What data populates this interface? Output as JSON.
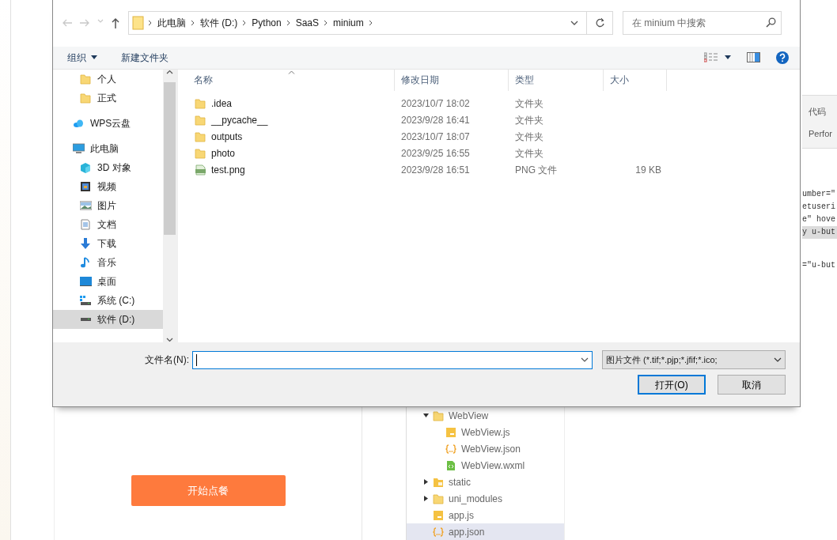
{
  "background": {
    "preview": {
      "button": "开始点餐"
    },
    "project_tree": {
      "items": [
        {
          "label": "WebView",
          "kind": "folder",
          "expanded": true,
          "selected": false,
          "children": [
            {
              "label": "WebView.js",
              "kind": "js",
              "selected": false
            },
            {
              "label": "WebView.json",
              "kind": "json",
              "selected": false
            },
            {
              "label": "WebView.wxml",
              "kind": "wxml",
              "selected": false
            }
          ]
        },
        {
          "label": "static",
          "kind": "folder-static",
          "expanded": false,
          "selected": false
        },
        {
          "label": "uni_modules",
          "kind": "folder",
          "expanded": false,
          "selected": false
        },
        {
          "label": "app.js",
          "kind": "js",
          "selected": false
        },
        {
          "label": "app.json",
          "kind": "json",
          "selected": true
        }
      ]
    },
    "side_tabs": [
      "代码",
      "Perfor"
    ],
    "code_lines": [
      {
        "text": "umber=\"",
        "highlighted": false
      },
      {
        "text": "etuseri",
        "highlighted": false
      },
      {
        "text": "e\" hove",
        "highlighted": false
      },
      {
        "text": "y u-but",
        "highlighted": true
      },
      {
        "text": "=\"u-but",
        "highlighted": false
      }
    ]
  },
  "dialog": {
    "nav_buttons": [
      {
        "kind": "back",
        "disabled": true
      },
      {
        "kind": "forward",
        "disabled": true
      },
      {
        "kind": "recent",
        "disabled": true
      },
      {
        "kind": "up",
        "disabled": false
      }
    ],
    "breadcrumbs": [
      "此电脑",
      "软件 (D:)",
      "Python",
      "SaaS",
      "minium"
    ],
    "search": {
      "placeholder": "在 minium 中搜索"
    },
    "toolbar": {
      "organize": "组织",
      "new_folder": "新建文件夹"
    },
    "nav_pane": {
      "items": [
        {
          "label": "个人",
          "kind": "folder",
          "selected": false
        },
        {
          "label": "正式",
          "kind": "folder",
          "selected": false
        },
        {
          "label": "WPS云盘",
          "kind": "cloud",
          "selected": false
        },
        {
          "label": "此电脑",
          "kind": "pc",
          "selected": false
        },
        {
          "label": "3D 对象",
          "kind": "cube",
          "selected": false
        },
        {
          "label": "视频",
          "kind": "film",
          "selected": false
        },
        {
          "label": "图片",
          "kind": "image",
          "selected": false
        },
        {
          "label": "文档",
          "kind": "doc",
          "selected": false
        },
        {
          "label": "下载",
          "kind": "download",
          "selected": false
        },
        {
          "label": "音乐",
          "kind": "music",
          "selected": false
        },
        {
          "label": "桌面",
          "kind": "desktop",
          "selected": false
        },
        {
          "label": "系统 (C:)",
          "kind": "drive-c",
          "selected": false
        },
        {
          "label": "软件 (D:)",
          "kind": "drive",
          "selected": true
        }
      ]
    },
    "columns": [
      {
        "label": "名称",
        "sorted": true
      },
      {
        "label": "修改日期",
        "sorted": false
      },
      {
        "label": "类型",
        "sorted": false
      },
      {
        "label": "大小",
        "sorted": false
      }
    ],
    "files": [
      {
        "name": ".idea",
        "kind": "folder",
        "date": "2023/10/7 18:02",
        "type": "文件夹"
      },
      {
        "name": "__pycache__",
        "kind": "folder",
        "date": "2023/9/28 16:41",
        "type": "文件夹"
      },
      {
        "name": "outputs",
        "kind": "folder",
        "date": "2023/10/7 18:07",
        "type": "文件夹"
      },
      {
        "name": "photo",
        "kind": "folder",
        "date": "2023/9/25 16:55",
        "type": "文件夹"
      },
      {
        "name": "test.png",
        "kind": "png",
        "date": "2023/9/28 16:51",
        "type": "PNG 文件",
        "size": "19 KB"
      }
    ],
    "filename_label": "文件名(N):",
    "filter": "图片文件 (*.tif;*.pjp;*.jfif;*.ico;",
    "buttons": [
      {
        "label": "打开(O)",
        "default": true
      },
      {
        "label": "取消",
        "default": false
      }
    ]
  }
}
